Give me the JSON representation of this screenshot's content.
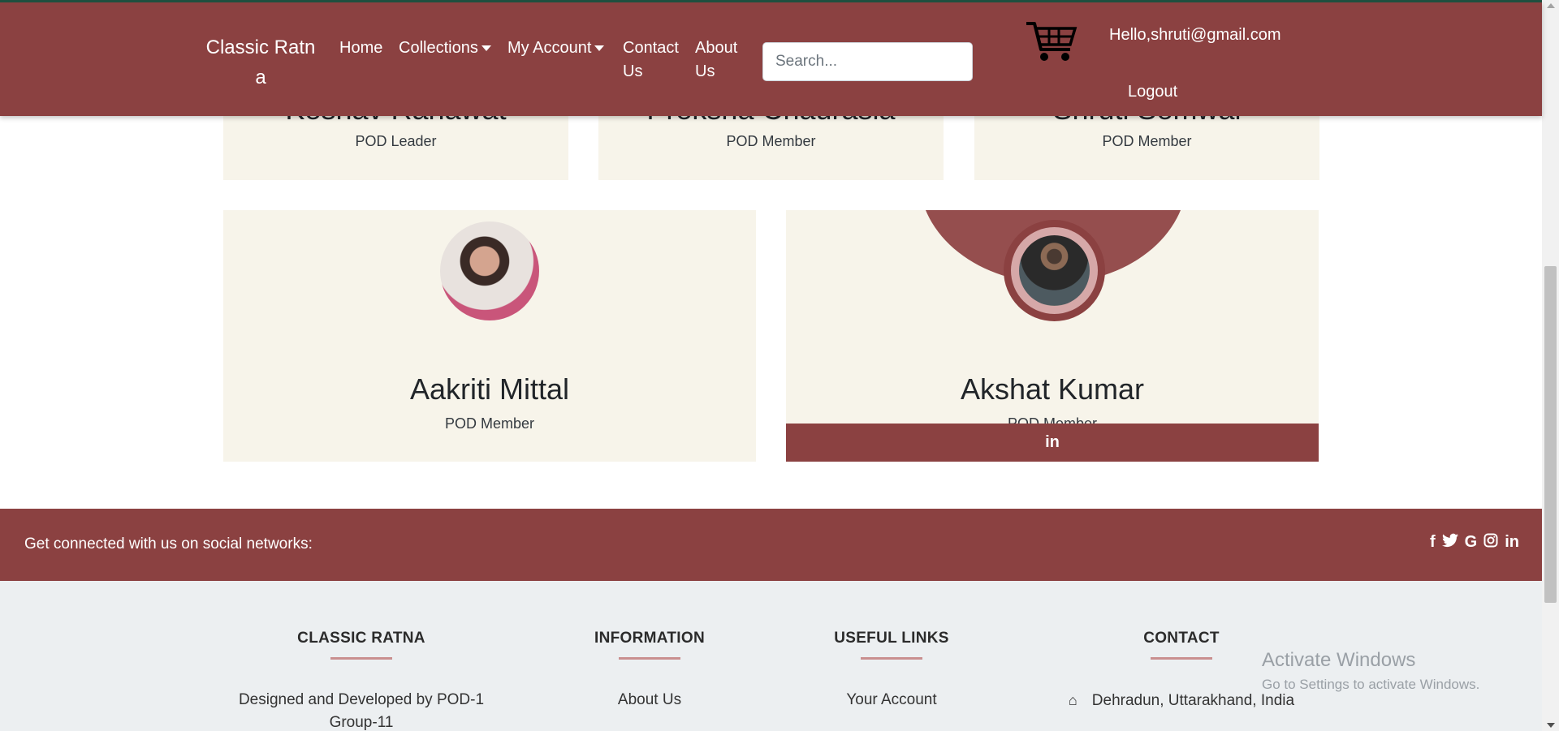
{
  "navbar": {
    "brand": "Classic Ratna",
    "home": "Home",
    "collections": "Collections",
    "my_account": "My Account",
    "contact_us": "Contact Us",
    "about_us": "About Us",
    "search_placeholder": "Search...",
    "greeting": "Hello,shruti@gmail.com",
    "logout": "Logout"
  },
  "team_top": [
    {
      "name": "Keshav Ranawat",
      "role": "POD Leader"
    },
    {
      "name": "Preksha Chaurasia",
      "role": "POD Member"
    },
    {
      "name": "Shruti Semwal",
      "role": "POD Member"
    }
  ],
  "team_bottom": [
    {
      "name": "Aakriti Mittal",
      "role": "POD Member"
    },
    {
      "name": "Akshat Kumar",
      "role": "POD Member",
      "social_icon": "linkedin-icon"
    }
  ],
  "social_strip": {
    "text": "Get connected with us on social networks:",
    "icons": [
      "facebook-icon",
      "twitter-icon",
      "google-icon",
      "instagram-icon",
      "linkedin-icon"
    ]
  },
  "footer": {
    "col1": {
      "heading": "CLASSIC RATNA",
      "item": "Designed and Developed by POD-1 Group-11"
    },
    "col2": {
      "heading": "INFORMATION",
      "item": "About Us"
    },
    "col3": {
      "heading": "USEFUL LINKS",
      "item": "Your Account"
    },
    "col4": {
      "heading": "CONTACT",
      "item": "Dehradun, Uttarakhand, India"
    }
  },
  "watermark": {
    "line1": "Activate Windows",
    "line2": "Go to Settings to activate Windows."
  },
  "colors": {
    "brand": "#8b4141",
    "card_bg": "#f7f4ea",
    "footer_bg": "#eceff1"
  }
}
